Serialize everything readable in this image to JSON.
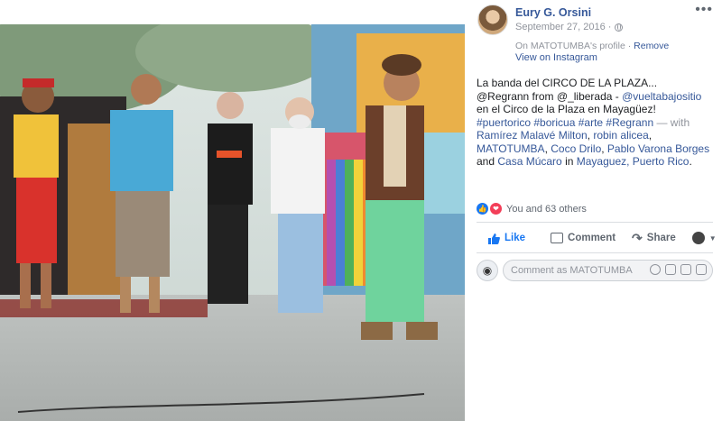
{
  "post": {
    "author": "Eury G. Orsini",
    "date": "September 27, 2016 · ",
    "more_label": "•••",
    "profile_prefix": "On MATOTUMBA's profile · ",
    "remove_label": "Remove",
    "view_instagram": "View on Instagram",
    "caption": {
      "line1": "La banda del CIRCO DE LA PLAZA...",
      "line2_start": "@Regrann from @_liberada - ",
      "mention": "@vueltabajositio",
      "line2_end": " en el Circo de la Plaza en Mayagüez!",
      "hashtags": "#puertorico #boricua #arte #Regrann",
      "with": " — with ",
      "tag1": "Ramírez Malavé Milton",
      "tag2": "robin alicea",
      "tag3": "MATOTUMBA",
      "tag4": "Coco Drilo",
      "tag5": "Pablo Varona Borges",
      "and": " and ",
      "tag6": "Casa Múcaro",
      "in": " in ",
      "place": "Mayaguez, Puerto Rico",
      "comma": ", ",
      "period": "."
    },
    "reactions_text": "You and 63 others",
    "actions": {
      "like": "Like",
      "comment": "Comment",
      "share": "Share"
    },
    "comment_placeholder": "Comment as MATOTUMBA"
  },
  "colors": {
    "link": "#365899",
    "like_blue": "#1877f2",
    "love_red": "#f33e58",
    "muted": "#90949c"
  }
}
